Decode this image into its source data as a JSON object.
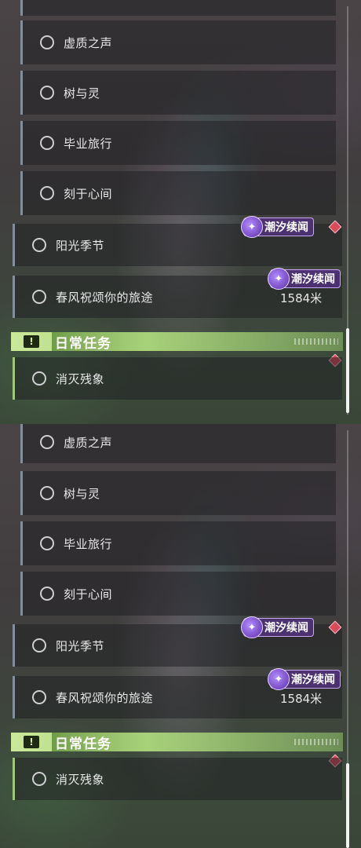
{
  "quests": [
    {
      "label": "虚质之声"
    },
    {
      "label": "树与灵"
    },
    {
      "label": "毕业旅行"
    },
    {
      "label": "刻于心间"
    },
    {
      "label": "阳光季节"
    },
    {
      "label": "春风祝颂你的旅途"
    }
  ],
  "badge_label": "潮汐续闻",
  "distance": "1584米",
  "daily": {
    "header": "日常任务",
    "items": [
      {
        "label": "消灭残象"
      }
    ]
  },
  "colors": {
    "daily_accent": "#a8d27a",
    "badge_bg": "#50327a",
    "marker": "#d94a5a"
  }
}
